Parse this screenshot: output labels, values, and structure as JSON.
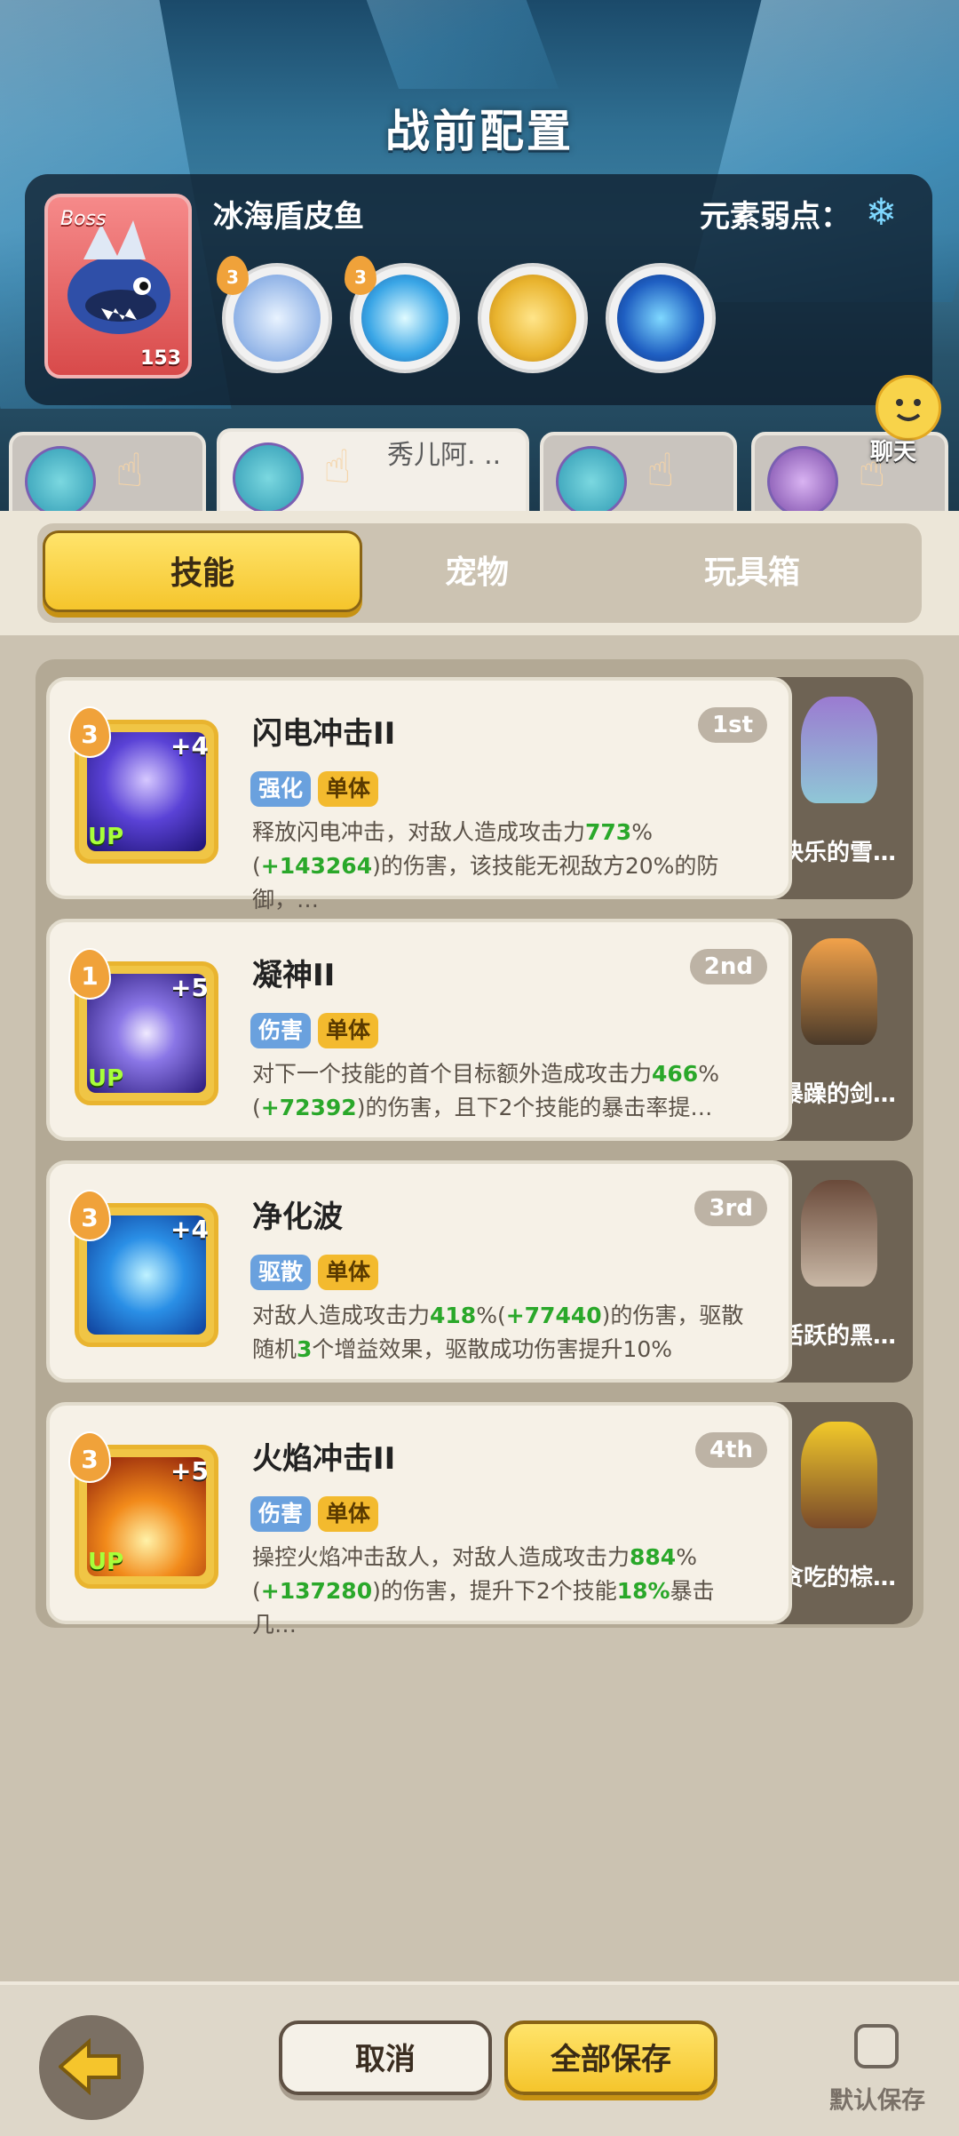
{
  "header": {
    "title": "战前配置"
  },
  "boss": {
    "tag": "Boss",
    "name": "冰海盾皮鱼",
    "level": "153",
    "weakness_label": "元素弱点：",
    "weakness_icon": "snowflake-icon",
    "skills": [
      {
        "icon": "ice-crystal-icon",
        "badge": "3",
        "color": "#a9c4ea"
      },
      {
        "icon": "ice-burst-icon",
        "badge": "3",
        "color": "#3aa6e6"
      },
      {
        "icon": "golden-shield-icon",
        "badge": "",
        "color": "#e9b42f"
      },
      {
        "icon": "water-star-icon",
        "badge": "",
        "color": "#1f5fc2"
      }
    ]
  },
  "players": [
    {
      "name": "",
      "active": false
    },
    {
      "name": "秀儿阿. ..",
      "active": true
    },
    {
      "name": "",
      "active": false
    },
    {
      "name": "",
      "active": false
    }
  ],
  "chat": {
    "label": "聊天"
  },
  "category_tabs": [
    "技能",
    "宠物",
    "玩具箱"
  ],
  "skills": [
    {
      "name": "闪电冲击II",
      "level": "3",
      "plus": "+4",
      "up": "UP",
      "rank": "1st",
      "tags": [
        "强化",
        "单体"
      ],
      "desc_parts": [
        "释放闪电冲击，对敌人造成攻击力",
        "773",
        "%(",
        "+143264",
        ")的伤害，该技能无视敌方20%的防御，…"
      ],
      "pet_name": "快乐的雪…",
      "icon_color": "#3d2bb5"
    },
    {
      "name": "凝神II",
      "level": "1",
      "plus": "+5",
      "up": "UP",
      "rank": "2nd",
      "tags": [
        "伤害",
        "单体"
      ],
      "desc_parts": [
        "对下一个技能的首个目标额外造成攻击力",
        "466",
        "%(",
        "+72392",
        ")的伤害，且下2个技能的暴击率提…"
      ],
      "pet_name": "暴躁的剑…",
      "icon_color": "#4b3aa8"
    },
    {
      "name": "净化波",
      "level": "3",
      "plus": "+4",
      "up": "",
      "rank": "3rd",
      "tags": [
        "驱散",
        "单体"
      ],
      "desc_parts": [
        "对敌人造成攻击力",
        "418",
        "%(",
        "+77440",
        ")的伤害，驱散随机",
        "3",
        "个增益效果，驱散成功伤害提升10%"
      ],
      "pet_name": "活跃的黑…",
      "icon_color": "#1f78d6"
    },
    {
      "name": "火焰冲击II",
      "level": "3",
      "plus": "+5",
      "up": "UP",
      "rank": "4th",
      "tags": [
        "伤害",
        "单体"
      ],
      "desc_parts": [
        "操控火焰冲击敌人，对敌人造成攻击力",
        "884",
        "%(",
        "+137280",
        ")的伤害，提升下2个技能",
        "18%",
        "暴击几…"
      ],
      "pet_name": "贪吃的棕…",
      "icon_color": "#d9431a"
    }
  ],
  "footer": {
    "cancel_label": "取消",
    "save_all_label": "全部保存",
    "default_save_label": "默认保存",
    "default_save_checked": false
  }
}
